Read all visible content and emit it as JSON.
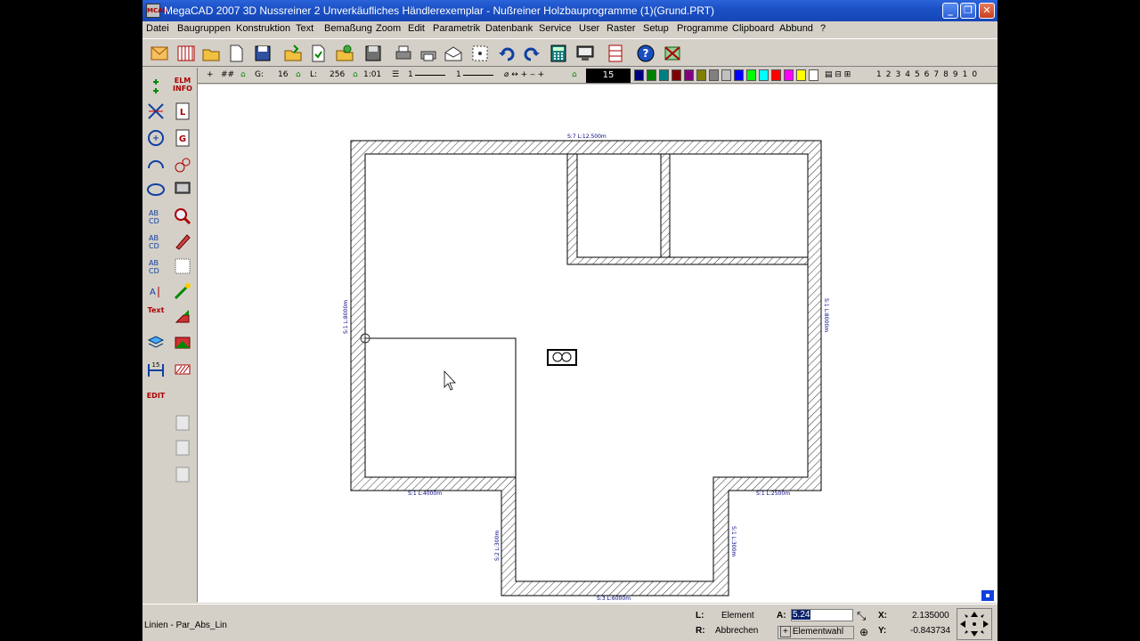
{
  "window": {
    "title": "MegaCAD 2007 3D Nussreiner 2 Unverkäufliches Händlerexemplar - Nußreiner Holzbauprogramme (1)(Grund.PRT)",
    "app_icon_text": "MCAD",
    "minimize": "_",
    "maximize": "❐",
    "close": "✕"
  },
  "menu": [
    "Datei",
    "Baugruppen",
    "Konstruktion",
    "Text",
    "Bemaßung",
    "Zoom",
    "Edit",
    "Parametrik",
    "Datenbank",
    "Service",
    "User",
    "Raster",
    "Setup",
    "Programme",
    "Clipboard",
    "Abbund",
    "?"
  ],
  "toolbar_icons": [
    "envelope-icon",
    "grid-icon",
    "open-folder-icon",
    "new-file-icon",
    "save-prt-icon",
    "folder-export-icon",
    "folder-import-icon",
    "folder-share-icon",
    "save-icon",
    "print-preview-icon",
    "print-icon",
    "envelope-open-icon",
    "pattern-icon",
    "undo-icon",
    "redo-icon",
    "calculator-icon",
    "screen-icon",
    "layout-icon",
    "help-icon",
    "close-tool-icon"
  ],
  "params": {
    "plus": "+",
    "grid": "##",
    "g_label": "G:",
    "g_value": "16",
    "l_label": "L:",
    "l_value": "256",
    "ratio": "1:01",
    "line1": "1",
    "line2": "1",
    "color_current": "15",
    "layers": [
      "1",
      "2",
      "3",
      "4",
      "5",
      "6",
      "7",
      "8",
      "9",
      "10"
    ]
  },
  "colors": [
    "#000080",
    "#008000",
    "#008080",
    "#800000",
    "#800080",
    "#808000",
    "#808080",
    "#c0c0c0",
    "#0000ff",
    "#00ff00",
    "#00ffff",
    "#ff0000",
    "#ff00ff",
    "#ffff00",
    "#ffffff"
  ],
  "palette": {
    "elm_info": "ELM\nINFO",
    "text_label": "Text",
    "edit_label": "EDIT",
    "layer_label": "15"
  },
  "drawing": {
    "dim_top": "S:7 L:12.500m",
    "dim_left": "S:1 L:8000m",
    "dim_right": "S:1 L:8000m",
    "dim_bottom_left": "S:1 L:4000m",
    "dim_bottom_mid": "S:3 L:6000m",
    "dim_bottom_right": "S:1 L:2500m",
    "dim_notch_left": "S:2 L:300m",
    "dim_notch_right": "S:1 L:300m"
  },
  "status": {
    "command": "Linien - Par_Abs_Lin",
    "l_label": "L:",
    "l_action": "Element",
    "r_label": "R:",
    "r_action": "Abbrechen",
    "a_label": "A:",
    "a_value": "5.24",
    "elementwahl": "Elementwahl",
    "x_label": "X:",
    "x_value": "2.135000",
    "y_label": "Y:",
    "y_value": "-0.843734"
  }
}
